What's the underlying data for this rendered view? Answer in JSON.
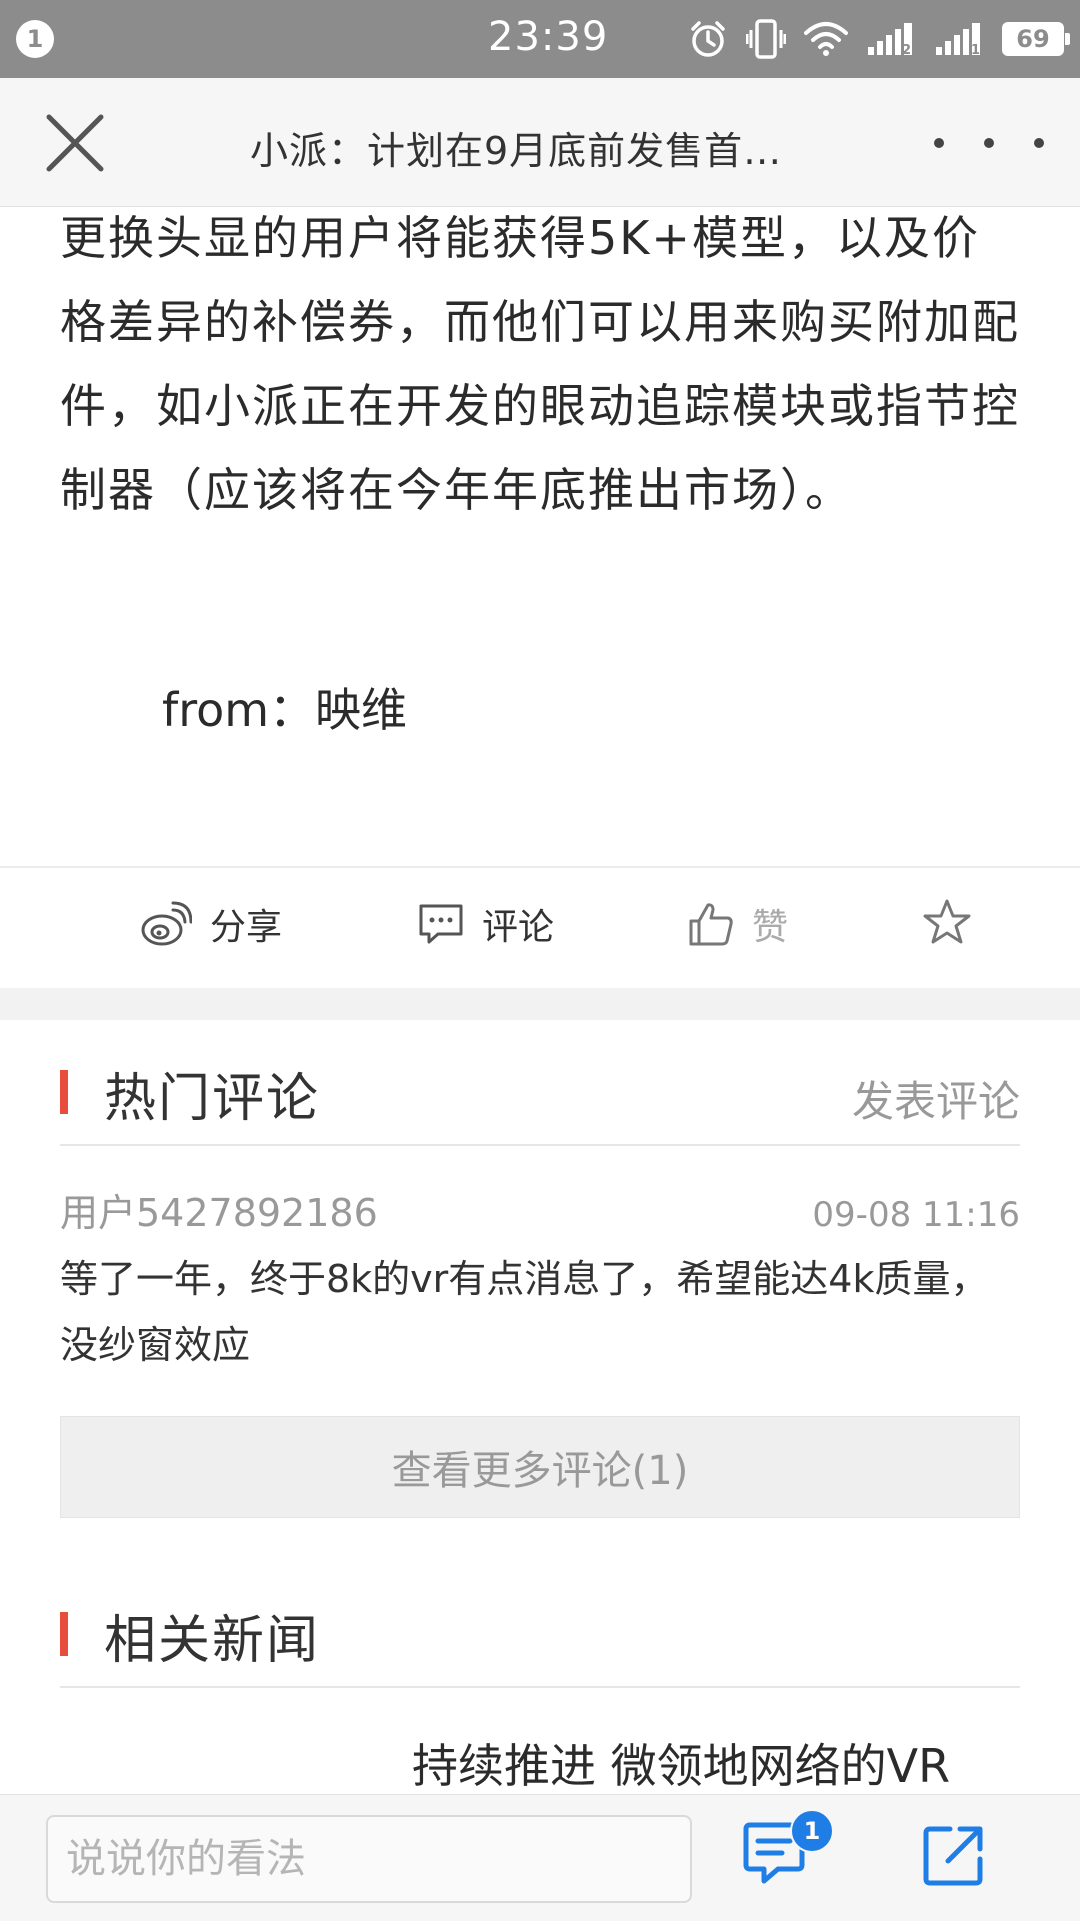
{
  "status_bar": {
    "notification_count": "1",
    "time": "23:39",
    "battery": "69",
    "sim1_label": "2",
    "sim2_label": "1"
  },
  "header": {
    "title": "小派：计划在9月底前发售首…"
  },
  "article": {
    "paragraph": "更换头显的用户将能获得5K+模型，以及价格差异的补偿券，而他们可以用来购买附加配件，如小派正在开发的眼动追踪模块或指节控制器（应该将在今年年底推出市场）。",
    "source": "from：映维"
  },
  "actions": {
    "share_label": "分享",
    "comment_label": "评论",
    "like_label": "赞"
  },
  "hot_comments": {
    "title": "热门评论",
    "post_label": "发表评论",
    "items": [
      {
        "user": "用户5427892186",
        "time": "09-08 11:16",
        "text": "等了一年，终于8k的vr有点消息了，希望能达4k质量，没纱窗效应"
      }
    ],
    "more_label": "查看更多评论(1)"
  },
  "related_news": {
    "title": "相关新闻",
    "items": [
      {
        "title": "持续推进 微领地网络的VR"
      }
    ]
  },
  "bottom_bar": {
    "input_placeholder": "说说你的看法",
    "comment_badge": "1"
  },
  "colors": {
    "accent_red": "#e84c3d",
    "accent_blue": "#1f7ee6",
    "status_bar_bg": "#8c8c8c"
  }
}
